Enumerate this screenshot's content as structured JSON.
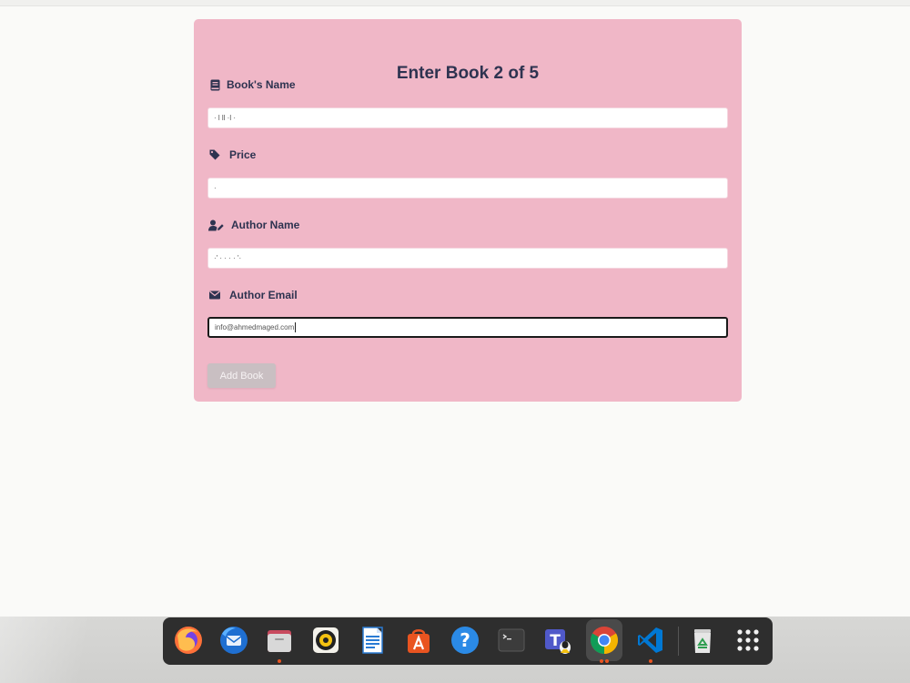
{
  "form": {
    "title": "Enter Book 2 of 5",
    "fields": [
      {
        "label": "Book's Name",
        "icon": "book-icon",
        "value": "· l ll ·l ·"
      },
      {
        "label": "Price",
        "icon": "tag-icon",
        "value": "·"
      },
      {
        "label": "Author Name",
        "icon": "user-edit-icon",
        "value": "·'  ·  ·  ·  ·  '·"
      },
      {
        "label": "Author Email",
        "icon": "envelope-icon",
        "value": "info@ahmedmaged.com"
      }
    ],
    "submit_label": "Add Book"
  },
  "dock": {
    "items": [
      "firefox-icon",
      "thunderbird-icon",
      "files-icon",
      "rhythmbox-icon",
      "writer-icon",
      "app-center-icon",
      "help-icon",
      "terminal-icon",
      "teams-icon",
      "chrome-icon",
      "vscode-icon",
      "trash-icon",
      "app-grid-icon"
    ]
  },
  "colors": {
    "card": "#f0b7c7",
    "text": "#2e3350",
    "accent": "#e95420"
  }
}
